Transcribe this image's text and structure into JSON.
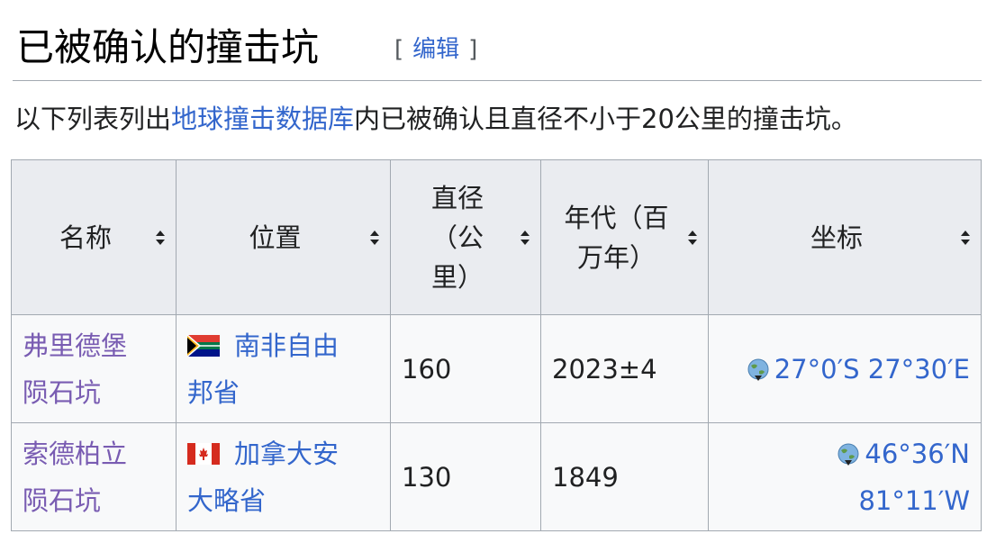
{
  "heading": {
    "title": "已被确认的撞击坑",
    "edit_open": "[",
    "edit_label": "编辑",
    "edit_close": "]"
  },
  "intro": {
    "before": "以下列表列出",
    "link": "地球撞击数据库",
    "after": "内已被确认且直径不小于20公里的撞击坑。"
  },
  "table": {
    "headers": [
      {
        "lines": [
          "名称"
        ]
      },
      {
        "lines": [
          "位置"
        ]
      },
      {
        "lines": [
          "直径",
          "（公",
          "里）"
        ]
      },
      {
        "lines": [
          "年代（百",
          "万年）"
        ]
      },
      {
        "lines": [
          "坐标"
        ]
      }
    ],
    "rows": [
      {
        "name_lines": [
          "弗里德堡",
          "陨石坑"
        ],
        "location_lines": [
          "南非自由",
          "邦省"
        ],
        "flag": "south-africa-flag",
        "diameter": "160",
        "age": "2023±4",
        "coord_lines": [
          "27°0′S 27°30′E"
        ]
      },
      {
        "name_lines": [
          "索德柏立",
          "陨石坑"
        ],
        "location_lines": [
          "加拿大安",
          "大略省"
        ],
        "flag": "canada-flag",
        "diameter": "130",
        "age": "1849",
        "coord_lines": [
          "46°36′N",
          "81°11′W"
        ]
      }
    ]
  },
  "colors": {
    "link": "#3366cc",
    "visited_link": "#795cb2",
    "header_bg": "#eaecf0",
    "cell_bg": "#f8f9fa",
    "border": "#a2a9b1"
  }
}
